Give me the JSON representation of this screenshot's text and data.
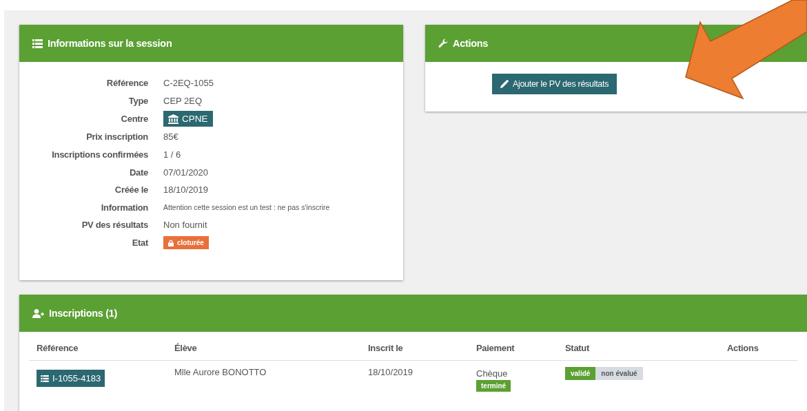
{
  "session_panel": {
    "title": "Informations sur la session",
    "fields": [
      {
        "label": "Référence",
        "value": "C-2EQ-1055",
        "kind": "text"
      },
      {
        "label": "Type",
        "value": "CEP 2EQ",
        "kind": "text"
      },
      {
        "label": "Centre",
        "value": "CPNE",
        "kind": "center_badge"
      },
      {
        "label": "Prix inscription",
        "value": "85€",
        "kind": "text"
      },
      {
        "label": "Inscriptions confirmées",
        "value": "1 / 6",
        "kind": "text"
      },
      {
        "label": "Date",
        "value": "07/01/2020",
        "kind": "text"
      },
      {
        "label": "Créée le",
        "value": "18/10/2019",
        "kind": "text"
      },
      {
        "label": "Information",
        "value": "Attention cette session est un test : ne pas s'inscrire",
        "kind": "note"
      },
      {
        "label": "PV des résultats",
        "value": "Non fournit",
        "kind": "text"
      },
      {
        "label": "Etat",
        "value": "cloturée",
        "kind": "status_badge"
      }
    ]
  },
  "actions_panel": {
    "title": "Actions",
    "buttons": [
      "Ajouter le PV des résultats"
    ]
  },
  "inscriptions_panel": {
    "title": "Inscriptions (1)",
    "columns": [
      "Référence",
      "Élève",
      "Inscrit le",
      "Paiement",
      "Statut",
      "Actions"
    ],
    "rows": [
      {
        "reference": "I-1055-4183",
        "student": "Mlle Aurore BONOTTO",
        "registered": "18/10/2019",
        "payment": "Chèque",
        "payment_status": "terminé",
        "statuses": [
          {
            "label": "validé",
            "color": "#5ba033"
          },
          {
            "label": "non évalué",
            "color": "#d6dce1"
          }
        ]
      }
    ]
  }
}
